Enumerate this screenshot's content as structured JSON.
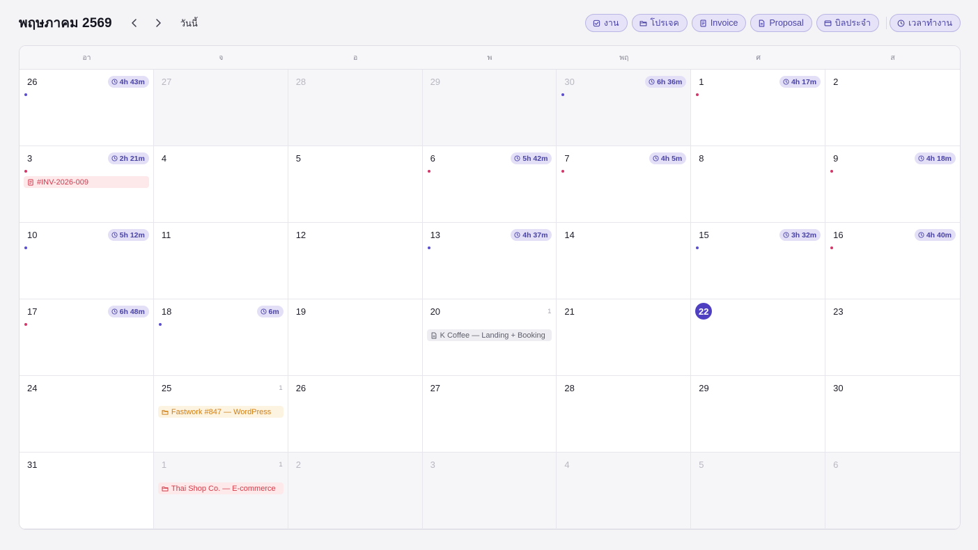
{
  "header": {
    "month_title": "พฤษภาคม 2569",
    "today_label": "วันนี้",
    "prev_icon": "chevron-left-icon",
    "next_icon": "chevron-right-icon"
  },
  "filters": [
    {
      "label": "งาน",
      "icon": "checkbox-icon"
    },
    {
      "label": "โปรเจค",
      "icon": "folder-icon"
    },
    {
      "label": "Invoice",
      "icon": "receipt-icon"
    },
    {
      "label": "Proposal",
      "icon": "document-icon"
    },
    {
      "label": "บิลประจำ",
      "icon": "recurring-bill-icon"
    }
  ],
  "worktime_filter": {
    "label": "เวลาทำงาน",
    "icon": "clock-icon"
  },
  "colors": {
    "accent": "#4f3fc1",
    "purple_dot": "#5b4fd0",
    "pink_dot": "#d2386a",
    "invoice_text": "#d23a4e",
    "project_orange": "#d08018"
  },
  "weekdays": [
    "อา",
    "จ",
    "อ",
    "พ",
    "พฤ",
    "ศ",
    "ส"
  ],
  "days": [
    {
      "day": "26",
      "muted": false,
      "time": "4h 43m",
      "dot": "purple"
    },
    {
      "day": "27",
      "muted": true
    },
    {
      "day": "28",
      "muted": true
    },
    {
      "day": "29",
      "muted": true
    },
    {
      "day": "30",
      "muted": true,
      "time": "6h 36m",
      "dot": "purple"
    },
    {
      "day": "1",
      "muted": false,
      "time": "4h 17m",
      "dot": "pink"
    },
    {
      "day": "2",
      "muted": false
    },
    {
      "day": "3",
      "muted": false,
      "time": "2h 21m",
      "dot": "pink",
      "event": {
        "label": "#INV-2026-009",
        "kind": "invoice",
        "icon": "receipt-icon"
      }
    },
    {
      "day": "4",
      "muted": false
    },
    {
      "day": "5",
      "muted": false
    },
    {
      "day": "6",
      "muted": false,
      "time": "5h 42m",
      "dot": "pink"
    },
    {
      "day": "7",
      "muted": false,
      "time": "4h 5m",
      "dot": "pink"
    },
    {
      "day": "8",
      "muted": false
    },
    {
      "day": "9",
      "muted": false,
      "time": "4h 18m",
      "dot": "pink"
    },
    {
      "day": "10",
      "muted": false,
      "time": "5h 12m",
      "dot": "purple"
    },
    {
      "day": "11",
      "muted": false
    },
    {
      "day": "12",
      "muted": false
    },
    {
      "day": "13",
      "muted": false,
      "time": "4h 37m",
      "dot": "purple"
    },
    {
      "day": "14",
      "muted": false
    },
    {
      "day": "15",
      "muted": false,
      "time": "3h 32m",
      "dot": "purple"
    },
    {
      "day": "16",
      "muted": false,
      "time": "4h 40m",
      "dot": "pink"
    },
    {
      "day": "17",
      "muted": false,
      "time": "6h 48m",
      "dot": "pink"
    },
    {
      "day": "18",
      "muted": false,
      "time": "6m",
      "dot": "purple"
    },
    {
      "day": "19",
      "muted": false
    },
    {
      "day": "20",
      "muted": false,
      "count": "1",
      "event": {
        "label": "K Coffee — Landing + Booking",
        "kind": "proposal",
        "icon": "document-icon"
      }
    },
    {
      "day": "21",
      "muted": false
    },
    {
      "day": "22",
      "muted": false,
      "today": true
    },
    {
      "day": "23",
      "muted": false
    },
    {
      "day": "24",
      "muted": false
    },
    {
      "day": "25",
      "muted": false,
      "count": "1",
      "event": {
        "label": "Fastwork #847 — WordPress",
        "kind": "project-orange",
        "icon": "folder-icon"
      }
    },
    {
      "day": "26",
      "muted": false
    },
    {
      "day": "27",
      "muted": false
    },
    {
      "day": "28",
      "muted": false
    },
    {
      "day": "29",
      "muted": false
    },
    {
      "day": "30",
      "muted": false
    },
    {
      "day": "31",
      "muted": false
    },
    {
      "day": "1",
      "muted": true,
      "count": "1",
      "event": {
        "label": "Thai Shop Co. — E-commerce",
        "kind": "project-red",
        "icon": "folder-icon"
      }
    },
    {
      "day": "2",
      "muted": true
    },
    {
      "day": "3",
      "muted": true
    },
    {
      "day": "4",
      "muted": true
    },
    {
      "day": "5",
      "muted": true
    },
    {
      "day": "6",
      "muted": true
    }
  ]
}
